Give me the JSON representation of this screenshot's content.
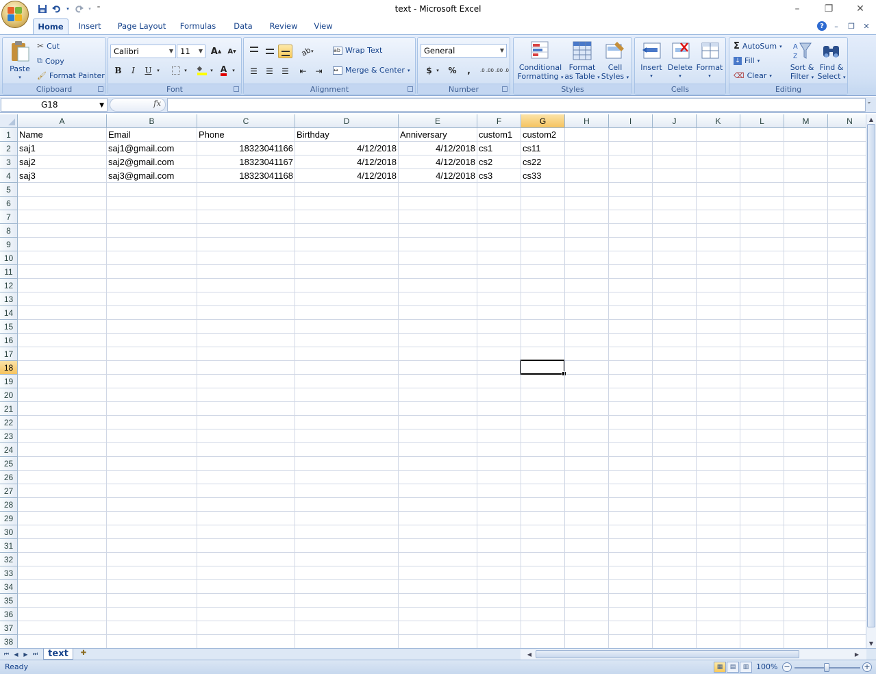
{
  "window": {
    "title": "text - Microsoft Excel",
    "minimize_glyph": "–",
    "restore_glyph": "❐",
    "close_glyph": "✕"
  },
  "tabs": [
    "Home",
    "Insert",
    "Page Layout",
    "Formulas",
    "Data",
    "Review",
    "View"
  ],
  "active_tab": "Home",
  "ribbon": {
    "clipboard": {
      "title": "Clipboard",
      "paste": "Paste",
      "cut": "Cut",
      "copy": "Copy",
      "format_painter": "Format Painter"
    },
    "font": {
      "title": "Font",
      "font_name": "Calibri",
      "font_size": "11",
      "bold": "B",
      "italic": "I",
      "underline": "U",
      "grow": "A",
      "shrink": "A",
      "font_color": "A"
    },
    "alignment": {
      "title": "Alignment",
      "wrap_text": "Wrap Text",
      "merge_center": "Merge & Center"
    },
    "number": {
      "title": "Number",
      "format": "General",
      "currency": "$",
      "percent": "%",
      "comma": ",",
      "inc_decimal": ".0 .00",
      "dec_decimal": ".00 .0"
    },
    "styles": {
      "title": "Styles",
      "conditional_l1": "Conditional",
      "conditional_l2": "Formatting",
      "format_table_l1": "Format",
      "format_table_l2": "as Table",
      "cell_styles_l1": "Cell",
      "cell_styles_l2": "Styles"
    },
    "cells": {
      "title": "Cells",
      "insert": "Insert",
      "delete": "Delete",
      "format": "Format"
    },
    "editing": {
      "title": "Editing",
      "autosum": "AutoSum",
      "fill": "Fill",
      "clear": "Clear",
      "sort_l1": "Sort &",
      "sort_l2": "Filter",
      "find_l1": "Find &",
      "find_l2": "Select"
    }
  },
  "formula_bar": {
    "name_box": "G18",
    "fx": "fx",
    "formula": ""
  },
  "columns": [
    "A",
    "B",
    "C",
    "D",
    "E",
    "F",
    "G",
    "H",
    "I",
    "J",
    "K",
    "L",
    "M",
    "N"
  ],
  "rows": [
    "1",
    "2",
    "3",
    "4",
    "5",
    "6",
    "7",
    "8",
    "9",
    "10",
    "11",
    "12",
    "13",
    "14",
    "15",
    "16",
    "17",
    "18",
    "19",
    "20",
    "21",
    "22",
    "23",
    "24",
    "25",
    "26",
    "27",
    "28",
    "29",
    "30",
    "31",
    "32",
    "33",
    "34",
    "35",
    "36",
    "37",
    "38"
  ],
  "selected": {
    "column": "G",
    "row": "18"
  },
  "sheet": {
    "header": [
      "Name",
      "Email",
      "Phone",
      "Birthday",
      "Anniversary",
      "custom1",
      "custom2"
    ],
    "data": [
      [
        "saj1",
        "saj1@gmail.com",
        "18323041166",
        "4/12/2018",
        "4/12/2018",
        "cs1",
        "cs11"
      ],
      [
        "saj2",
        "saj2@gmail.com",
        "18323041167",
        "4/12/2018",
        "4/12/2018",
        "cs2",
        "cs22"
      ],
      [
        "saj3",
        "saj3@gmail.com",
        "18323041168",
        "4/12/2018",
        "4/12/2018",
        "cs3",
        "cs33"
      ]
    ],
    "numeric_columns": [
      2,
      3,
      4
    ]
  },
  "sheet_tabs": [
    "text"
  ],
  "status": {
    "text": "Ready",
    "zoom": "100%",
    "zoom_minus": "−",
    "zoom_plus": "+"
  }
}
